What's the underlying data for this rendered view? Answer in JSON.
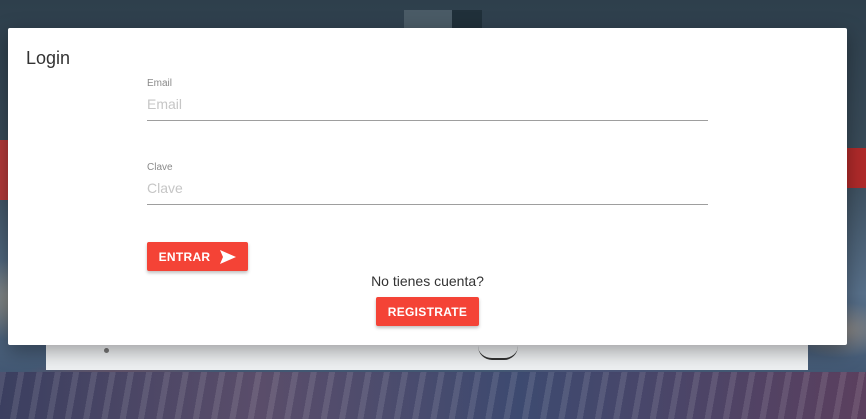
{
  "modal": {
    "title": "Login",
    "email": {
      "label": "Email",
      "placeholder": "Email",
      "value": ""
    },
    "clave": {
      "label": "Clave",
      "placeholder": "Clave",
      "value": ""
    },
    "login_button": {
      "label": "ENTRAR",
      "icon": "send-icon"
    },
    "no_account_text": "No tienes cuenta?",
    "register_button": {
      "label": "REGISTRATE"
    }
  },
  "colors": {
    "accent": "#f44336",
    "modal_background": "#ffffff",
    "text": "#333333",
    "label": "#8a8a8a",
    "placeholder": "#c6c6c6",
    "underline": "#9e9e9e"
  }
}
